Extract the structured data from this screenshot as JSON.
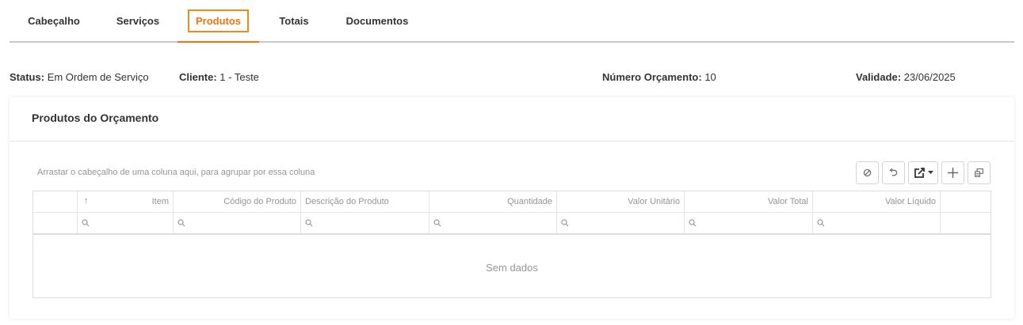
{
  "tabs": [
    {
      "label": "Cabeçalho",
      "active": false
    },
    {
      "label": "Serviços",
      "active": false
    },
    {
      "label": "Produtos",
      "active": true
    },
    {
      "label": "Totais",
      "active": false
    },
    {
      "label": "Documentos",
      "active": false
    }
  ],
  "info": {
    "status_label": "Status:",
    "status_value": "Em Ordem de Serviço",
    "cliente_label": "Cliente:",
    "cliente_value": "1 - Teste",
    "numero_label": "Número Orçamento:",
    "numero_value": "10",
    "validade_label": "Validade:",
    "validade_value": "23/06/2025"
  },
  "card": {
    "title": "Produtos do Orçamento",
    "group_panel_text": "Arrastar o cabeçalho de uma coluna aqui, para agrupar por essa coluna"
  },
  "toolbar": {
    "icons": [
      "refresh-icon",
      "undo-icon",
      "export-icon",
      "add-icon",
      "column-chooser-icon"
    ]
  },
  "grid": {
    "sort_indicator": "↑",
    "columns": [
      "Item",
      "Código do Produto",
      "Descrição do Produto",
      "Quantidade",
      "Valor Unitário",
      "Valor Total",
      "Valor Líquido"
    ],
    "empty_text": "Sem dados"
  },
  "colors": {
    "accent": "#e8750f",
    "tab_border": "#f08a14",
    "muted_text": "#959595"
  }
}
